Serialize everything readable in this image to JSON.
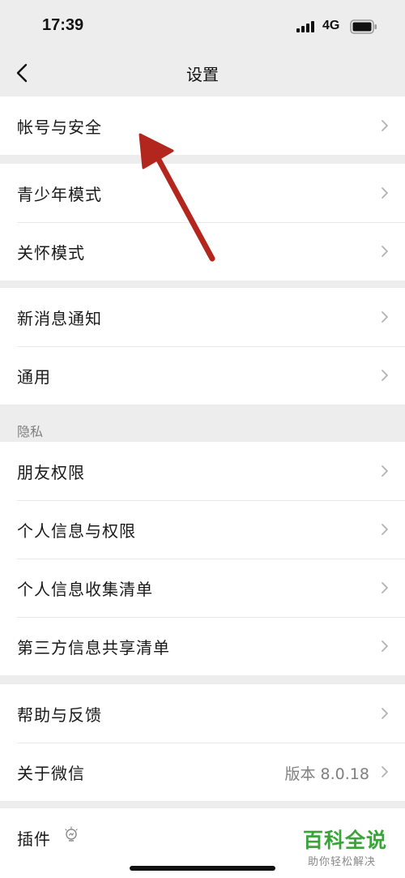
{
  "status_bar": {
    "time": "17:39",
    "network": "4G"
  },
  "nav": {
    "title": "设置"
  },
  "groups": {
    "account": {
      "items": [
        {
          "label": "帐号与安全"
        }
      ]
    },
    "modes": {
      "items": [
        {
          "label": "青少年模式"
        },
        {
          "label": "关怀模式"
        }
      ]
    },
    "general": {
      "items": [
        {
          "label": "新消息通知"
        },
        {
          "label": "通用"
        }
      ]
    },
    "privacy": {
      "header": "隐私",
      "items": [
        {
          "label": "朋友权限"
        },
        {
          "label": "个人信息与权限"
        },
        {
          "label": "个人信息收集清单"
        },
        {
          "label": "第三方信息共享清单"
        }
      ]
    },
    "help": {
      "items": [
        {
          "label": "帮助与反馈"
        },
        {
          "label": "关于微信",
          "value": "版本 8.0.18"
        }
      ]
    },
    "plugins": {
      "items": [
        {
          "label": "插件"
        }
      ]
    }
  },
  "watermark": {
    "title": "百科全说",
    "subtitle": "助你轻松解决"
  },
  "colors": {
    "background": "#ededed",
    "card": "#ffffff",
    "annotation_arrow": "#b3261e",
    "watermark_green": "#3aa43a"
  },
  "icons": {
    "back": "chevron-left-icon",
    "row_chevron": "chevron-right-icon",
    "plugin": "plugin-bulb-icon"
  }
}
